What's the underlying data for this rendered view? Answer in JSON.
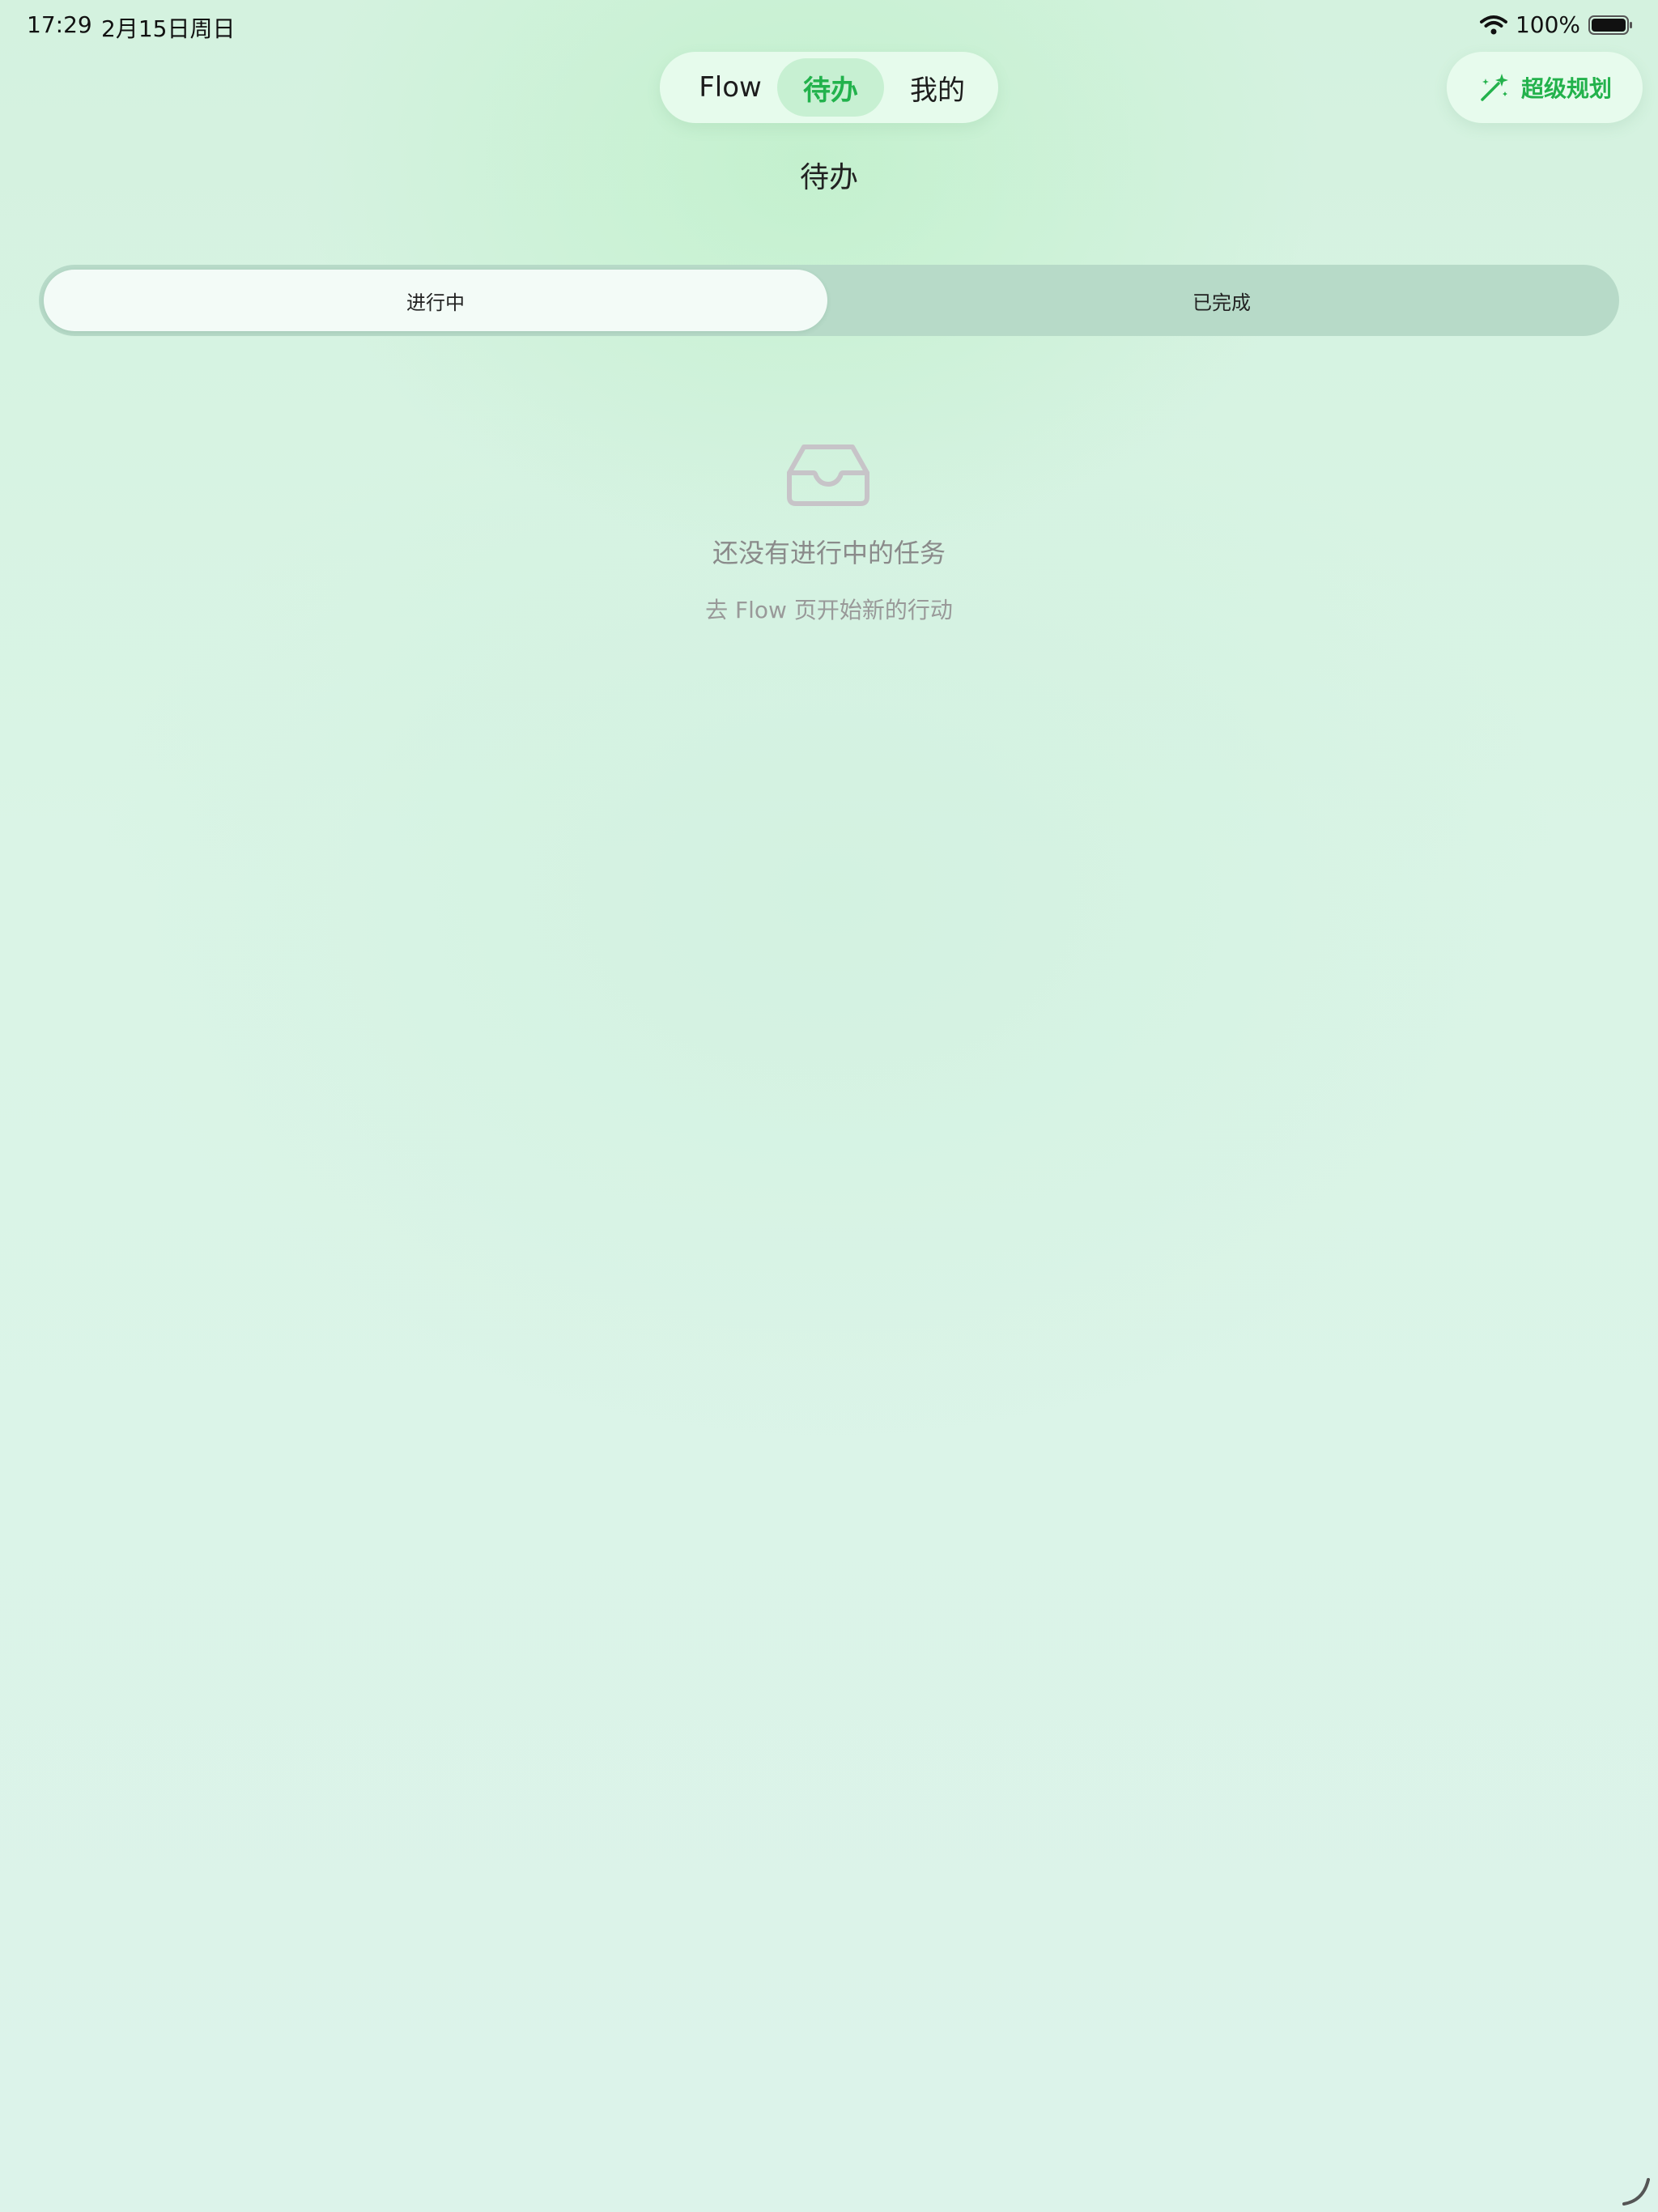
{
  "status_bar": {
    "time": "17:29",
    "date": "2月15日周日",
    "battery": "100%",
    "icons": [
      "wifi-icon",
      "battery-icon"
    ]
  },
  "top_nav": {
    "tabs": [
      {
        "label": "Flow",
        "selected": false
      },
      {
        "label": "待办",
        "selected": true
      },
      {
        "label": "我的",
        "selected": false
      }
    ]
  },
  "super_plan": {
    "label": "超级规划",
    "icon": "magic-wand-icon"
  },
  "page": {
    "title": "待办"
  },
  "filter_tabs": [
    {
      "label": "进行中",
      "selected": true
    },
    {
      "label": "已完成",
      "selected": false
    }
  ],
  "empty_state": {
    "icon": "inbox-icon",
    "title": "还没有进行中的任务",
    "subtitle": "去 Flow 页开始新的行动"
  },
  "colors": {
    "accent": "#22b24c",
    "background": "#d9f3e4",
    "segment_track": "#b7dac8",
    "muted_text": "#8a8a8a"
  }
}
